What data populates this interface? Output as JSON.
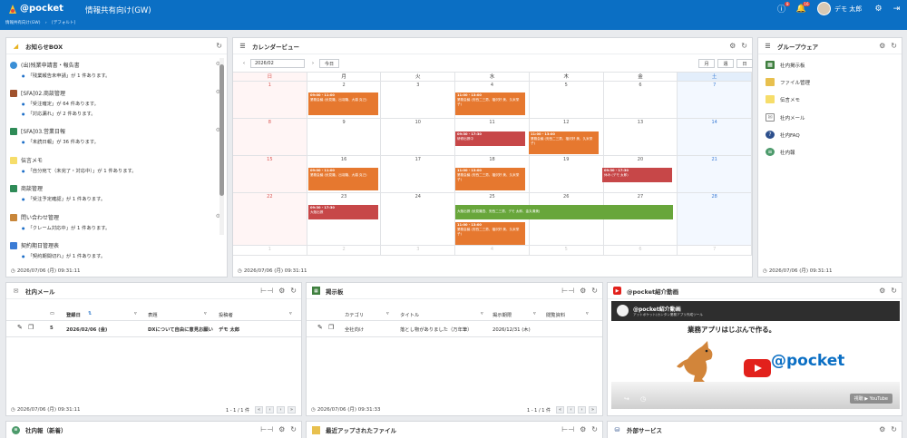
{
  "header": {
    "logo": "@pocket",
    "title": "情報共有向け(GW)",
    "help_badge": "8",
    "notif_badge": "16",
    "user_name": "デモ 太郎"
  },
  "breadcrumb": [
    "情報共有向け(GW)",
    "›",
    "[デフォルト]"
  ],
  "news_box": {
    "title": "お知らせBOX",
    "items": [
      {
        "title": "(出)残業申請書・報告書",
        "lines": [
          "「残業報告未申請」が 1 件あります。"
        ]
      },
      {
        "title": "[SFA]02.商談管理",
        "lines": [
          "「受注確定」が 64 件あります。",
          "「対応漏れ」が 2 件あります。"
        ]
      },
      {
        "title": "[SFA]03.営業日報",
        "lines": [
          "「未読日報」が 36 件あります。"
        ]
      },
      {
        "title": "伝言メモ",
        "lines": [
          "「自分宛て（未完了・対応中）」が 1 件あります。"
        ]
      },
      {
        "title": "商談管理",
        "lines": [
          "「受注予定確認」が 1 件あります。"
        ]
      },
      {
        "title": "問い合わせ管理",
        "lines": [
          "「クレーム対応中」が 1 件あります。"
        ]
      },
      {
        "title": "契約期日管理表",
        "lines": [
          "「契約期間切れ」が 1 件あります。"
        ]
      }
    ],
    "footer": "2026/07/06 (月) 09:31:11"
  },
  "calendar": {
    "title": "カレンダービュー",
    "month": "2026/02",
    "today": "今日",
    "views": [
      "月",
      "週",
      "日"
    ],
    "weekdays": [
      "日",
      "月",
      "火",
      "水",
      "木",
      "金",
      "土"
    ],
    "weeks": [
      [
        "1",
        "2",
        "3",
        "4",
        "5",
        "6",
        "7"
      ],
      [
        "8",
        "9",
        "10",
        "11",
        "12",
        "13",
        "14"
      ],
      [
        "15",
        "16",
        "17",
        "18",
        "19",
        "20",
        "21"
      ],
      [
        "22",
        "23",
        "24",
        "25",
        "26",
        "27",
        "28"
      ],
      [
        "1",
        "2",
        "3",
        "4",
        "5",
        "6",
        "7"
      ]
    ],
    "events": [
      {
        "time": "09:00 - 11:00",
        "text": "業務会議 (伏見隆、出羽隆、大橋 克己)",
        "color": "orange"
      },
      {
        "time": "11:00 - 13:00",
        "text": "業務会議 (安西二三男、福沢好 美、久米栄子)",
        "color": "orange"
      },
      {
        "time": "09:30 - 17:30",
        "text": "研修出張中",
        "color": "red"
      },
      {
        "time": "11:00 - 13:00",
        "text": "業務会議 (安西二三男、福沢好 美、久米栄子)",
        "color": "orange"
      },
      {
        "time": "09:00 - 11:00",
        "text": "業務会議 (伏見隆、出羽隆、大橋 克己)",
        "color": "orange"
      },
      {
        "time": "11:00 - 13:00",
        "text": "業務会議 (安西二三男、福沢好 美、久米栄子)",
        "color": "orange"
      },
      {
        "time": "09:30 - 17:30",
        "text": "休み (デモ 太郎)",
        "color": "red"
      },
      {
        "time": "09:30 - 17:30",
        "text": "大阪出張",
        "color": "red"
      },
      {
        "time": "",
        "text": "大阪出張 (伏見隆吾、安西二三男、デモ 太郎、金丸清美)",
        "color": "green"
      },
      {
        "time": "11:00 - 13:00",
        "text": "業務会議 (安西二三男、福沢好 美、久米栄子)",
        "color": "orange"
      }
    ],
    "footer": "2026/07/06 (月) 09:31:11"
  },
  "groupware": {
    "title": "グループウェア",
    "items": [
      "社内掲示板",
      "ファイル管理",
      "伝言メモ",
      "社内メール",
      "社内FAQ",
      "社内報"
    ],
    "footer": "2026/07/06 (月) 09:31:11"
  },
  "mail": {
    "title": "社内メール",
    "headers": [
      "登録日",
      "表題",
      "投稿者"
    ],
    "row": {
      "count": "5",
      "date": "2026/02/06 (金)",
      "subject": "DXについて自由に意見お願い",
      "author": "デモ 太郎"
    },
    "footer": "2026/07/06 (月) 09:31:11",
    "pager": "1 - 1 / 1 件"
  },
  "board": {
    "title": "掲示板",
    "headers": [
      "カテゴリ",
      "タイトル",
      "掲示期限",
      "閲覧資料"
    ],
    "row": {
      "category": "全社向け",
      "title": "落とし物がありました（万年筆）",
      "deadline": "2026/12/31 (木)"
    },
    "footer": "2026/07/06 (月) 09:31:33",
    "pager": "1 - 1 / 1 件"
  },
  "video": {
    "title": "@pocket紹介動画",
    "video_title": "@pocket紹介動画",
    "video_sub": "アットポケット(カンタン業務アプリ作成ツール",
    "tagline": "業務アプリはじぶんで作る。",
    "brand": "@pocket",
    "watch_on": "視聴 ▶ YouTube"
  },
  "bottom_panels": {
    "news": "社内報（新着）",
    "files": "最近アップされたファイル",
    "external": "外部サービス"
  },
  "colors": {
    "header": "#0b6fc4",
    "event_orange": "#e6782f",
    "event_red": "#c74748",
    "event_green": "#68a63b"
  }
}
